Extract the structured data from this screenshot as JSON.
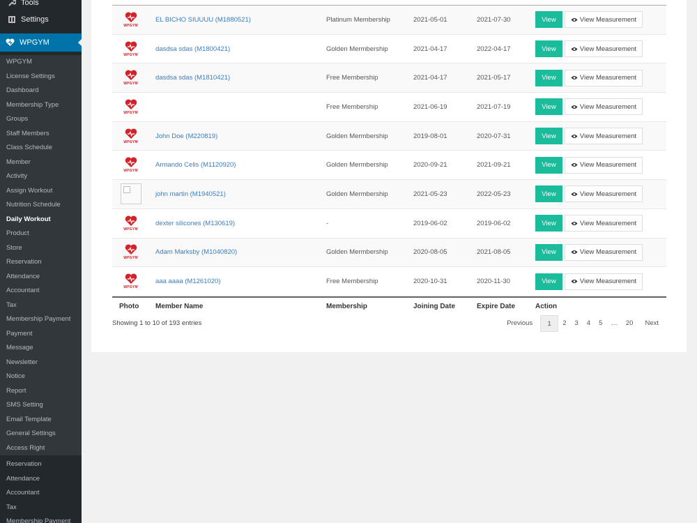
{
  "admin_menu": {
    "tools": "Tools",
    "settings": "Settings",
    "wpgym": "WPGYM"
  },
  "submenu": [
    "WPGYM",
    "License Settings",
    "Dashboard",
    "Membership Type",
    "Groups",
    "Staff Members",
    "Class Schedule",
    "Member",
    "Activity",
    "Assign Workout",
    "Nutrition Schedule",
    "Daily Workout",
    "Product",
    "Store",
    "Reservation",
    "Attendance",
    "Accountant",
    "Tax",
    "Membership Payment",
    "Payment",
    "Message",
    "Newsletter",
    "Notice",
    "Report",
    "SMS Setting",
    "Email Template",
    "General Settings",
    "Access Right"
  ],
  "submenu_active": "Daily Workout",
  "submenu_extra": [
    "Reservation",
    "Attendance",
    "Accountant",
    "Tax",
    "Membership Payment"
  ],
  "logo_text": "WPGYM",
  "table": {
    "columns": [
      "Photo",
      "Member Name",
      "Membership",
      "Joining Date",
      "Expire Date",
      "Action"
    ],
    "view_label": "View",
    "measurement_label": "View Measurement",
    "rows": [
      {
        "photo": "logo",
        "name": "EL BICHO SIUUUU (M1880521)",
        "membership": "Platinum Membership",
        "joining": "2021-05-01",
        "expire": "2021-07-30"
      },
      {
        "photo": "logo",
        "name": "dasdsa sdas (M1800421)",
        "membership": "Golden Mermbership",
        "joining": "2021-04-17",
        "expire": "2022-04-17"
      },
      {
        "photo": "logo",
        "name": "dasdsa sdas (M1810421)",
        "membership": "Free Membership",
        "joining": "2021-04-17",
        "expire": "2021-05-17"
      },
      {
        "photo": "logo",
        "name": "",
        "membership": "Free Membership",
        "joining": "2021-06-19",
        "expire": "2021-07-19"
      },
      {
        "photo": "logo",
        "name": "John Doe (M220819)",
        "membership": "Golden Mermbership",
        "joining": "2019-08-01",
        "expire": "2020-07-31"
      },
      {
        "photo": "logo",
        "name": "Armando Celis (M1120920)",
        "membership": "Golden Mermbership",
        "joining": "2020-09-21",
        "expire": "2021-09-21"
      },
      {
        "photo": "placeholder",
        "name": "john martin (M1940521)",
        "membership": "Golden Mermbership",
        "joining": "2021-05-23",
        "expire": "2022-05-23"
      },
      {
        "photo": "logo",
        "name": "dexter silicones (M130619)",
        "membership": "-",
        "joining": "2019-06-02",
        "expire": "2019-06-02"
      },
      {
        "photo": "logo",
        "name": "Adam Marksby (M1040820)",
        "membership": "Golden Mermbership",
        "joining": "2020-08-05",
        "expire": "2021-08-05"
      },
      {
        "photo": "logo",
        "name": "aaa aaaa (M1261020)",
        "membership": "Free Membership",
        "joining": "2020-10-31",
        "expire": "2020-11-30"
      }
    ]
  },
  "footer": {
    "entries_info": "Showing 1 to 10 of 193 entries",
    "previous": "Previous",
    "next": "Next",
    "pages": [
      "1",
      "2",
      "3",
      "4",
      "5",
      "…",
      "20"
    ],
    "current_page": "1"
  },
  "colors": {
    "sidebar_bg": "#23282d",
    "submenu_bg": "#32373c",
    "active_blue": "#0073aa",
    "view_button": "#1abc9c",
    "link": "#3b7dbf",
    "logo_red": "#d2232a"
  }
}
